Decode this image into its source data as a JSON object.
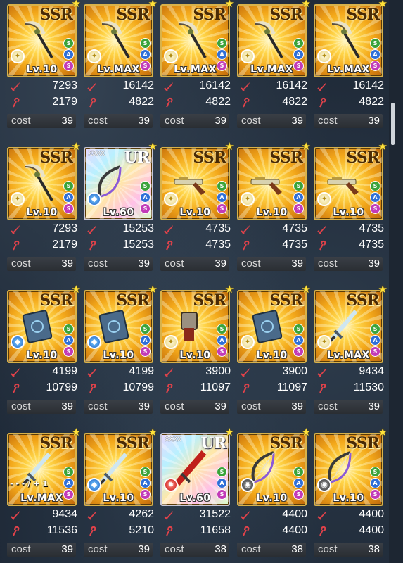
{
  "rows": [
    [
      {
        "rarity": "SSR",
        "level": "Lv.10",
        "attack": "7293",
        "magic": "2179",
        "cost_label": "cost",
        "cost": "39",
        "weapon": "scythe-icon",
        "element": "light-element-icon",
        "element_glyph": "✦",
        "badges": [
          "S",
          "A",
          "S"
        ],
        "ur": false
      },
      {
        "rarity": "SSR",
        "level": "Lv.MAX",
        "attack": "16142",
        "magic": "4822",
        "cost_label": "cost",
        "cost": "39",
        "weapon": "scythe-icon",
        "element": "light-element-icon",
        "element_glyph": "✦",
        "badges": [
          "S",
          "A",
          "S"
        ],
        "ur": false
      },
      {
        "rarity": "SSR",
        "level": "Lv.MAX",
        "attack": "16142",
        "magic": "4822",
        "cost_label": "cost",
        "cost": "39",
        "weapon": "scythe-icon",
        "element": "light-element-icon",
        "element_glyph": "✦",
        "badges": [
          "S",
          "A",
          "S"
        ],
        "ur": false
      },
      {
        "rarity": "SSR",
        "level": "Lv.MAX",
        "attack": "16142",
        "magic": "4822",
        "cost_label": "cost",
        "cost": "39",
        "weapon": "scythe-icon",
        "element": "light-element-icon",
        "element_glyph": "✦",
        "badges": [
          "S",
          "A",
          "S"
        ],
        "ur": false
      },
      {
        "rarity": "SSR",
        "level": "Lv.MAX",
        "attack": "16142",
        "magic": "4822",
        "cost_label": "cost",
        "cost": "39",
        "weapon": "scythe-icon",
        "element": "light-element-icon",
        "element_glyph": "✦",
        "badges": [
          "S",
          "A",
          "S"
        ],
        "ur": false
      }
    ],
    [
      {
        "rarity": "SSR",
        "level": "Lv.10",
        "attack": "7293",
        "magic": "2179",
        "cost_label": "cost",
        "cost": "39",
        "weapon": "scythe-icon",
        "element": "light-element-icon",
        "element_glyph": "✦",
        "badges": [
          "S",
          "A",
          "S"
        ],
        "ur": false
      },
      {
        "rarity": "UR",
        "level": "Lv.60",
        "attack": "15253",
        "magic": "15253",
        "cost_label": "cost",
        "cost": "39",
        "weapon": "bow-icon",
        "element": "water-element-icon",
        "element_glyph": "◆",
        "badges": [
          "S",
          "A",
          "S"
        ],
        "ur": true,
        "crosses": "XXXX"
      },
      {
        "rarity": "SSR",
        "level": "Lv.10",
        "attack": "4735",
        "magic": "4735",
        "cost_label": "cost",
        "cost": "39",
        "weapon": "gun-icon",
        "element": "light-element-icon",
        "element_glyph": "✦",
        "badges": [
          "S",
          "A",
          "S"
        ],
        "ur": false
      },
      {
        "rarity": "SSR",
        "level": "Lv.10",
        "attack": "4735",
        "magic": "4735",
        "cost_label": "cost",
        "cost": "39",
        "weapon": "gun-icon",
        "element": "light-element-icon",
        "element_glyph": "✦",
        "badges": [
          "S",
          "A",
          "S"
        ],
        "ur": false
      },
      {
        "rarity": "SSR",
        "level": "Lv.10",
        "attack": "4735",
        "magic": "4735",
        "cost_label": "cost",
        "cost": "39",
        "weapon": "gun-icon",
        "element": "light-element-icon",
        "element_glyph": "✦",
        "badges": [
          "S",
          "A",
          "S"
        ],
        "ur": false
      }
    ],
    [
      {
        "rarity": "SSR",
        "level": "Lv.10",
        "attack": "4199",
        "magic": "10799",
        "cost_label": "cost",
        "cost": "39",
        "weapon": "book-icon",
        "element": "water-element-icon",
        "element_glyph": "◆",
        "badges": [
          "S",
          "A",
          "S"
        ],
        "ur": false
      },
      {
        "rarity": "SSR",
        "level": "Lv.10",
        "attack": "4199",
        "magic": "10799",
        "cost_label": "cost",
        "cost": "39",
        "weapon": "book-icon",
        "element": "water-element-icon",
        "element_glyph": "◆",
        "badges": [
          "S",
          "A",
          "S"
        ],
        "ur": false
      },
      {
        "rarity": "SSR",
        "level": "Lv.10",
        "attack": "3900",
        "magic": "11097",
        "cost_label": "cost",
        "cost": "39",
        "weapon": "gauntlet-icon",
        "element": "light-element-icon",
        "element_glyph": "✦",
        "badges": [
          "S",
          "A",
          "S"
        ],
        "ur": false
      },
      {
        "rarity": "SSR",
        "level": "Lv.10",
        "attack": "3900",
        "magic": "11097",
        "cost_label": "cost",
        "cost": "39",
        "weapon": "book-icon",
        "element": "light-element-icon",
        "element_glyph": "✦",
        "badges": [
          "S",
          "A",
          "S"
        ],
        "ur": false
      },
      {
        "rarity": "SSR",
        "level": "Lv.MAX",
        "attack": "9434",
        "magic": "11530",
        "cost_label": "cost",
        "cost": "39",
        "weapon": "sword-icon",
        "element": "light-element-icon",
        "element_glyph": "✦",
        "badges": [
          "S",
          "A",
          "S"
        ],
        "ur": false
      }
    ],
    [
      {
        "rarity": "SSR",
        "level": "Lv.MAX",
        "attack": "9434",
        "magic": "11536",
        "cost_label": "cost",
        "cost": "39",
        "weapon": "sword-icon",
        "element": "light-element-icon",
        "element_glyph": "✦",
        "badges": [
          "S",
          "A",
          "S"
        ],
        "ur": false,
        "plus": "- - - / + 1"
      },
      {
        "rarity": "SSR",
        "level": "Lv.10",
        "attack": "4262",
        "magic": "5210",
        "cost_label": "cost",
        "cost": "39",
        "weapon": "sword-icon",
        "element": "water-element-icon",
        "element_glyph": "◆",
        "badges": [
          "S",
          "A",
          "S"
        ],
        "ur": false
      },
      {
        "rarity": "UR",
        "level": "Lv.60",
        "attack": "31522",
        "magic": "11658",
        "cost_label": "cost",
        "cost": "38",
        "weapon": "greatsword-icon",
        "element": "fire-element-icon",
        "element_glyph": "✹",
        "badges": [
          "S",
          "A",
          "S"
        ],
        "ur": true,
        "crosses": "XXXX"
      },
      {
        "rarity": "SSR",
        "level": "Lv.10",
        "attack": "4400",
        "magic": "4400",
        "cost_label": "cost",
        "cost": "38",
        "weapon": "bow-icon",
        "element": "dark-element-icon",
        "element_glyph": "◉",
        "badges": [
          "S",
          "A",
          "S"
        ],
        "ur": false
      },
      {
        "rarity": "SSR",
        "level": "Lv.10",
        "attack": "4400",
        "magic": "4400",
        "cost_label": "cost",
        "cost": "38",
        "weapon": "bow-icon",
        "element": "dark-element-icon",
        "element_glyph": "◉",
        "badges": [
          "S",
          "A",
          "S"
        ],
        "ur": false
      }
    ]
  ],
  "colors": {
    "gold_frame": "#d9b24a",
    "stat_icon": "#e0424a",
    "cost_bar": "#33383e"
  }
}
